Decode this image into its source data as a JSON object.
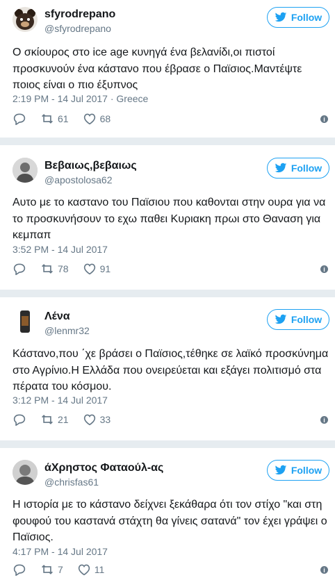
{
  "tweets": [
    {
      "name": "sfyrodrepano",
      "handle": "@sfyrodrepano",
      "follow_label": "Follow",
      "text": "Ο σκίουρος στο ice age κυνηγά ένα βελανίδι,οι πιστοί προσκυνούν ένα κάστανο που έβρασε ο Παϊσιος.Μαντέψτε ποιος είναι ο πιο έξυπνος",
      "meta": "2:19 PM - 14 Jul 2017 · Greece",
      "retweets": "61",
      "likes": "68",
      "avatar_color": "#3a2a20"
    },
    {
      "name": "Βεβαιως,βεβαιως",
      "handle": "@apostolosa62",
      "follow_label": "Follow",
      "text": "Αυτο με το καστανο του Παϊσιου που καθονται στην ουρα για να το προσκυνήσουν το εχω παθει Κυριακη πρωι στο Θαναση για κεμπαπ",
      "meta": "3:52 PM - 14 Jul 2017",
      "retweets": "78",
      "likes": "91",
      "avatar_color": "#8a8a8a"
    },
    {
      "name": "Λένα",
      "handle": "@lenmr32",
      "follow_label": "Follow",
      "text": "Κάστανο,που ΄χε βράσει ο Παϊσιος,τέθηκε σε λαϊκό προσκύνημα στο Αγρίνιο.Η Ελλάδα που ονειρεύεται και εξάγει πολιτισμό στα πέρατα του κόσμου.",
      "meta": "3:12 PM - 14 Jul 2017",
      "retweets": "21",
      "likes": "33",
      "avatar_color": "#2b2b2b"
    },
    {
      "name": "άΧρηστος Φαταούλ-ας",
      "handle": "@chrisfas61",
      "follow_label": "Follow",
      "text": "Η ιστορία με το κάστανο δείχνει ξεκάθαρα ότι τον στίχο \"και στη φουφού του καστανά στάχτη θα γίνεις σατανά\" τον έχει γράψει ο Παϊσιος.",
      "meta": "4:17 PM - 14 Jul 2017",
      "retweets": "7",
      "likes": "11",
      "avatar_color": "#6b6b6b"
    }
  ],
  "colors": {
    "accent": "#1da1f2",
    "muted": "#657786",
    "divider": "#e6ecf0"
  }
}
